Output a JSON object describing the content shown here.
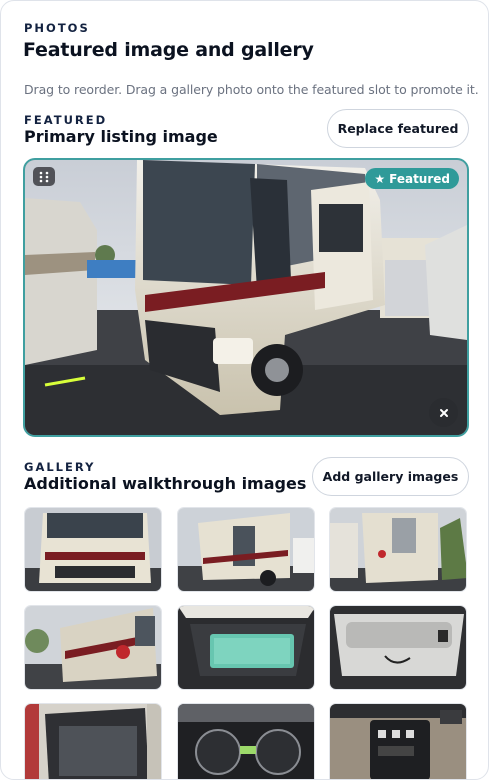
{
  "section": {
    "eyebrow": "PHOTOS",
    "title": "Featured image and gallery",
    "helper": "Drag to reorder. Drag a gallery photo onto the featured slot to promote it."
  },
  "featured": {
    "eyebrow": "FEATURED",
    "subtitle": "Primary listing image",
    "replace_label": "Replace featured",
    "badge_label": "Featured",
    "badge_icon": "star-icon",
    "drag_icon": "grip-icon",
    "remove_icon": "close-icon",
    "image_alt": "Class A motorhome parked in a dealer lot",
    "accent_color": "#3f9fa0"
  },
  "gallery": {
    "eyebrow": "GALLERY",
    "subtitle": "Additional walkthrough images",
    "add_label": "Add gallery images",
    "thumbnails": [
      {
        "alt": "Motorhome front view"
      },
      {
        "alt": "Motorhome side exterior"
      },
      {
        "alt": "Motorhome rear view"
      },
      {
        "alt": "Motorhome driver side"
      },
      {
        "alt": "Open exterior storage bay"
      },
      {
        "alt": "Utility compartment"
      },
      {
        "alt": "Open compartment door"
      },
      {
        "alt": "Dashboard gauges"
      },
      {
        "alt": "Control panel"
      }
    ]
  }
}
